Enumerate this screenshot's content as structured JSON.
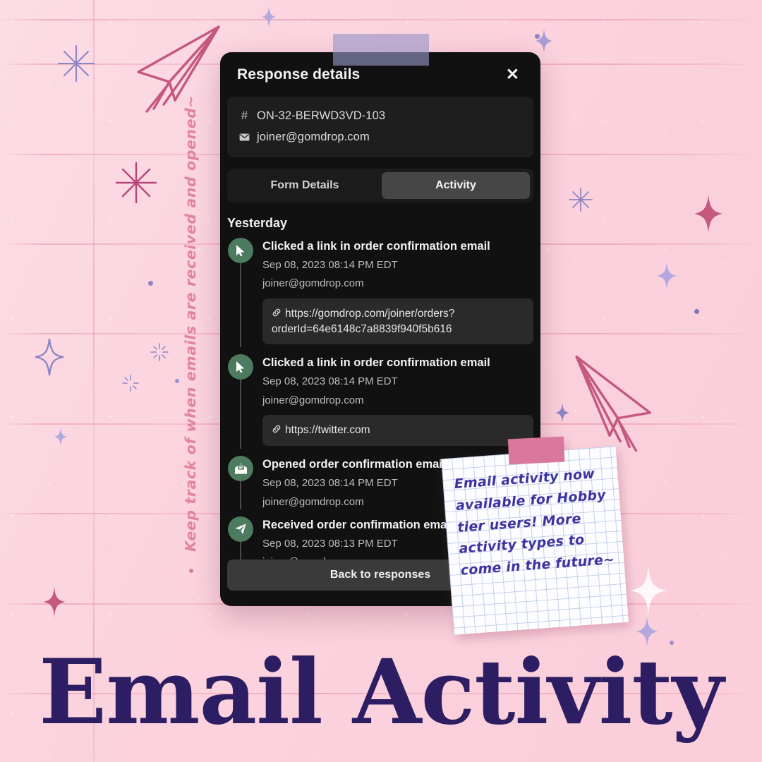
{
  "poster": {
    "title": "Email Activity",
    "vertical_caption": "Keep track of when emails are received and opened~",
    "note": "Email activity now available for Hobby tier users! More activity types to come in the future~",
    "colors": {
      "background": "#fbd3de",
      "rule_line": "#e78ea7",
      "title": "#2d1d63",
      "caption": "#e2849f",
      "note_ink": "#3b32a0",
      "note_tape": "#d9789c",
      "top_tape": "#9696c8",
      "doodle": "#c4587e",
      "sparkle_purple": "#8d85c4",
      "sparkle_pink": "#c4587e",
      "panel_bg": "#111111",
      "icon_green": "#4c7b5f"
    }
  },
  "panel": {
    "title": "Response details",
    "close_label": "✕",
    "meta": [
      {
        "icon": "hash-icon",
        "glyph": "#",
        "text": "ON-32-BERWD3VD-103"
      },
      {
        "icon": "envelope-icon",
        "glyph": "✉",
        "text": "joiner@gomdrop.com"
      }
    ],
    "tabs": [
      {
        "label": "Form Details",
        "active": false
      },
      {
        "label": "Activity",
        "active": true
      }
    ],
    "day_label": "Yesterday",
    "activity": [
      {
        "icon": "cursor-click-icon",
        "title": "Clicked a link in order confirmation email",
        "timestamp": "Sep 08, 2023 08:14 PM EDT",
        "email": "joiner@gomdrop.com",
        "link": "https://gomdrop.com/joiner/orders?orderId=64e6148c7a8839f940f5b616"
      },
      {
        "icon": "cursor-click-icon",
        "title": "Clicked a link in order confirmation email",
        "timestamp": "Sep 08, 2023 08:14 PM EDT",
        "email": "joiner@gomdrop.com",
        "link": "https://twitter.com"
      },
      {
        "icon": "open-envelope-icon",
        "title": "Opened order confirmation email",
        "timestamp": "Sep 08, 2023 08:14 PM EDT",
        "email": "joiner@gomdrop.com",
        "link": null
      },
      {
        "icon": "paper-plane-icon",
        "title": "Received order confirmation email",
        "timestamp": "Sep 08, 2023 08:13 PM EDT",
        "email": "joiner@gomdrop.com",
        "link": null
      }
    ],
    "back_button": "Back to responses"
  }
}
